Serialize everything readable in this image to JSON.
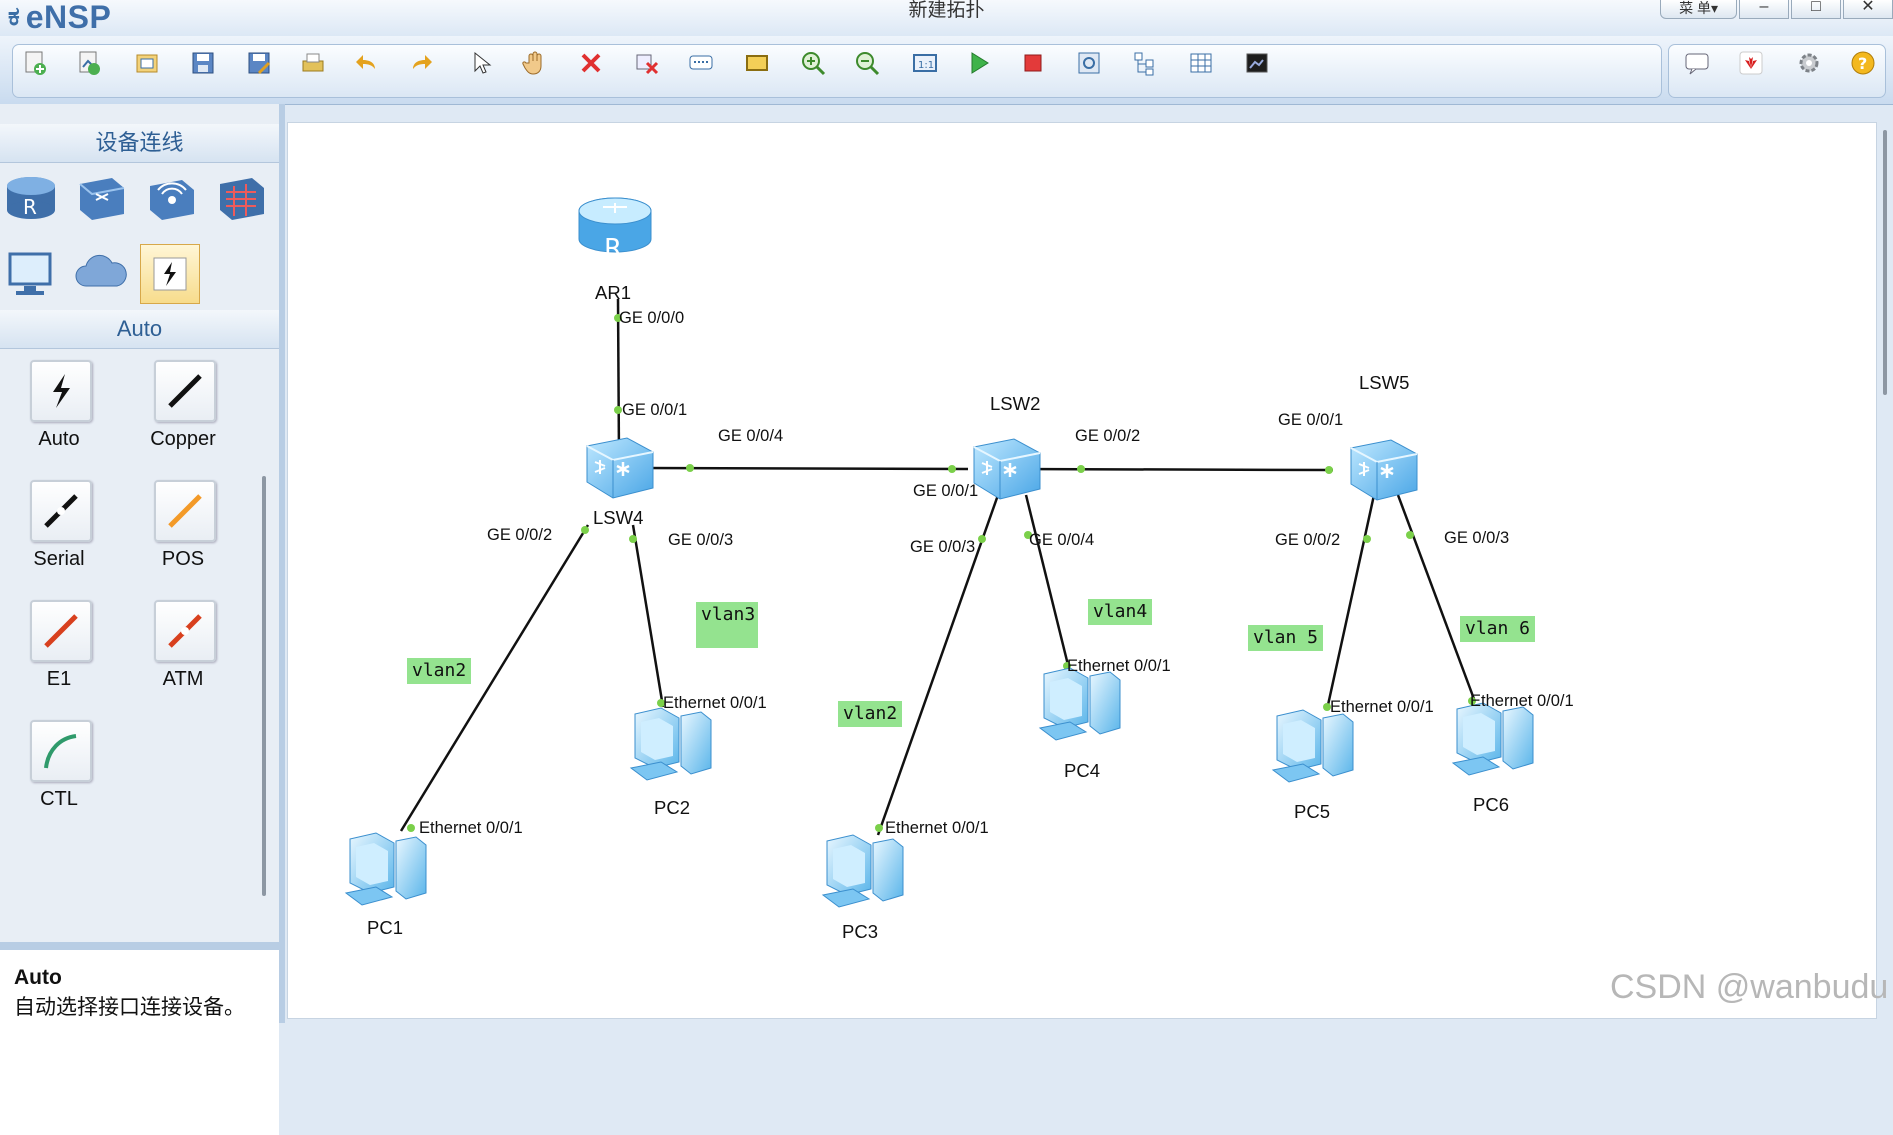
{
  "app": {
    "logo_text": "eNSP",
    "window_title": "新建拓扑",
    "menu_label": "菜 单▾",
    "min": "–",
    "max": "□",
    "close": "✕"
  },
  "sidebar": {
    "devices_header": "设备连线",
    "auto_header": "Auto",
    "cables": [
      {
        "label": "Auto"
      },
      {
        "label": "Copper"
      },
      {
        "label": "Serial"
      },
      {
        "label": "POS"
      },
      {
        "label": "E1"
      },
      {
        "label": "ATM"
      },
      {
        "label": "CTL"
      }
    ],
    "desc_title": "Auto",
    "desc_text": "自动选择接口连接设备。"
  },
  "topology": {
    "nodes": {
      "ar1": "AR1",
      "lsw4": "LSW4",
      "lsw2": "LSW2",
      "lsw5": "LSW5",
      "pc1": "PC1",
      "pc2": "PC2",
      "pc3": "PC3",
      "pc4": "PC4",
      "pc5": "PC5",
      "pc6": "PC6"
    },
    "ports": {
      "ar1_ge000": "GE 0/0/0",
      "lsw4_ge001": "GE 0/0/1",
      "lsw4_ge004": "GE 0/0/4",
      "lsw4_ge002": "GE 0/0/2",
      "lsw4_ge003": "GE 0/0/3",
      "lsw2_ge001": "GE 0/0/1",
      "lsw2_ge002": "GE 0/0/2",
      "lsw2_ge003": "GE 0/0/3",
      "lsw2_ge004": "GE 0/0/4",
      "lsw5_ge001": "GE 0/0/1",
      "lsw5_ge002": "GE 0/0/2",
      "lsw5_ge003": "GE 0/0/3",
      "pc1_eth": "Ethernet 0/0/1",
      "pc2_eth": "Ethernet 0/0/1",
      "pc3_eth": "Ethernet 0/0/1",
      "pc4_eth": "Ethernet 0/0/1",
      "pc5_eth": "Ethernet 0/0/1",
      "pc6_eth": "Ethernet 0/0/1"
    },
    "vlans": {
      "pc1": "vlan2",
      "pc2": "vlan3",
      "pc3": "vlan2",
      "pc4": "vlan4",
      "pc5": "vlan 5",
      "pc6": "vlan 6"
    }
  },
  "watermark": "CSDN @wanbudu",
  "colors": {
    "accent": "#3f6fa9",
    "vlan_label": "#94e38f",
    "port_dot": "#7bd04a"
  }
}
